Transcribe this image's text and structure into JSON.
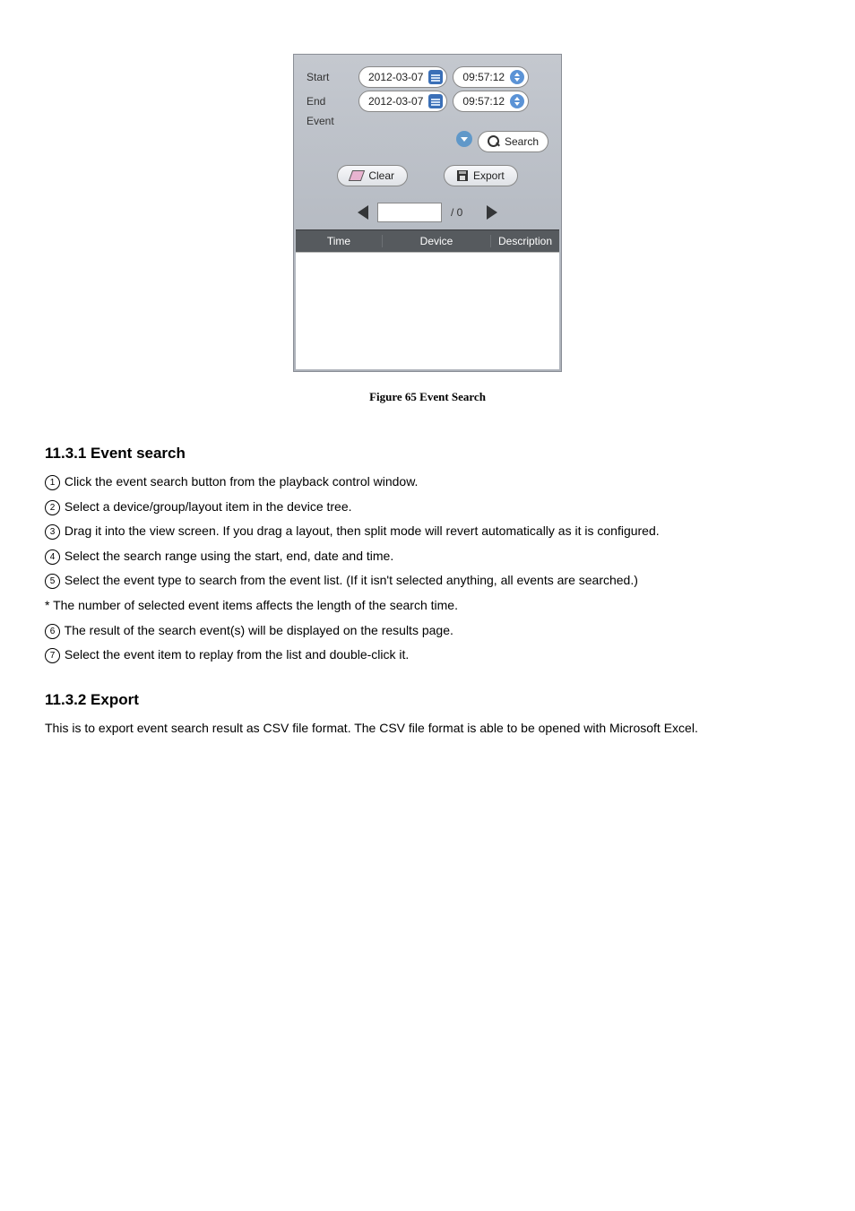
{
  "panel": {
    "start_label": "Start",
    "end_label": "End",
    "event_label": "Event",
    "start_date": "2012-03-07",
    "start_time": "09:57:12",
    "end_date": "2012-03-07",
    "end_time": "09:57:12",
    "search_btn": "Search",
    "clear_btn": "Clear",
    "export_btn": "Export",
    "page_text": "/  0",
    "columns": {
      "time": "Time",
      "device": "Device",
      "desc": "Description"
    }
  },
  "figure_caption": "Figure 65 Event Search",
  "sections": {
    "s1_heading": "11.3.1 Event search",
    "s1_steps": {
      "n1": "1",
      "t1": " Click the event search button from the playback control window.",
      "n2": "2",
      "t2": " Select a device/group/layout item in the device tree.",
      "n3": "3",
      "t3": " Drag it into the view screen. If you drag a layout, then split mode will revert automatically as it is configured.",
      "n4": "4",
      "t4": " Select the search range using the start, end, date and time.",
      "n5": "5",
      "t5": " Select the event type to search from the event list. (If it isn't selected anything, all events are searched.)",
      "note": "* The number of selected event items affects the length of the search time.",
      "n6": "6",
      "t6": " The result of the search event(s) will be displayed on the results page.",
      "n7": "7",
      "t7": " Select the event item to replay from the list and double-click it."
    },
    "s2_heading": "11.3.2 Export",
    "s2_body": "This is to export event search result as CSV file format. The CSV file format is able to be opened with Microsoft Excel."
  }
}
